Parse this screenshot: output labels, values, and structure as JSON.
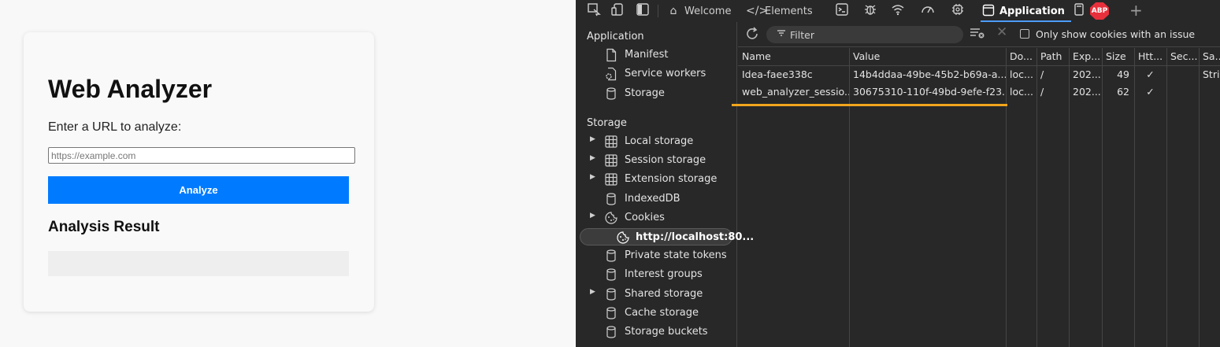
{
  "webpage": {
    "title": "Web Analyzer",
    "prompt": "Enter a URL to analyze:",
    "url_placeholder": "https://example.com",
    "url_value": "",
    "analyze_label": "Analyze",
    "result_heading": "Analysis Result",
    "result_text": ""
  },
  "devtools": {
    "tabs": [
      {
        "label": "Welcome",
        "icon": "home-icon"
      },
      {
        "label": "Elements",
        "icon": "code-icon"
      },
      {
        "label": "Application",
        "icon": "window-icon",
        "active": true
      }
    ],
    "abp_label": "ABP",
    "sidebar": {
      "application_heading": "Application",
      "application_items": [
        {
          "label": "Manifest",
          "icon": "file-icon"
        },
        {
          "label": "Service workers",
          "icon": "gear-file-icon"
        },
        {
          "label": "Storage",
          "icon": "database-icon"
        }
      ],
      "storage_heading": "Storage",
      "storage_items": [
        {
          "label": "Local storage",
          "icon": "grid-icon",
          "expandable": true
        },
        {
          "label": "Session storage",
          "icon": "grid-icon",
          "expandable": true
        },
        {
          "label": "Extension storage",
          "icon": "grid-icon",
          "expandable": true
        },
        {
          "label": "IndexedDB",
          "icon": "database-icon",
          "expandable": false
        },
        {
          "label": "Cookies",
          "icon": "cookie-icon",
          "expandable": true
        },
        {
          "label": "http://localhost:80...",
          "icon": "cookie-icon",
          "selected": true
        },
        {
          "label": "Private state tokens",
          "icon": "database-icon",
          "expandable": false
        },
        {
          "label": "Interest groups",
          "icon": "database-icon",
          "expandable": false
        },
        {
          "label": "Shared storage",
          "icon": "database-icon",
          "expandable": true
        },
        {
          "label": "Cache storage",
          "icon": "database-icon",
          "expandable": false
        },
        {
          "label": "Storage buckets",
          "icon": "database-icon",
          "expandable": false
        }
      ]
    },
    "toolbar": {
      "filter_placeholder": "Filter",
      "only_issue_label": "Only show cookies with an issue",
      "only_issue_checked": false
    },
    "cookie_table": {
      "columns": [
        "Name",
        "Value",
        "Do...",
        "Path",
        "Exp...",
        "Size",
        "Htt...",
        "Sec...",
        "Sa..."
      ],
      "rows": [
        [
          "Idea-faee338c",
          "14b4ddaa-49be-45b2-b69a-a...",
          "loc...",
          "/",
          "202...",
          "49",
          "✓",
          "",
          "Stric"
        ],
        [
          "web_analyzer_sessio...",
          "30675310-110f-49bd-9efe-f23...",
          "loc...",
          "/",
          "202...",
          "62",
          "✓",
          "",
          ""
        ]
      ],
      "highlight_color": "#f2a51c"
    }
  }
}
